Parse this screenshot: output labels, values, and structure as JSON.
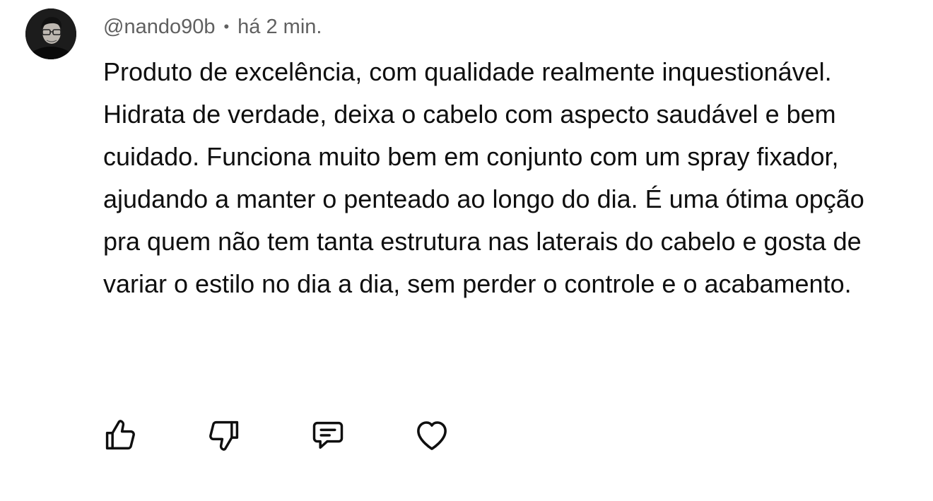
{
  "comment": {
    "author": "@nando90b",
    "separator": "•",
    "timestamp": "há 2 min.",
    "text": "Produto de excelência, com qualidade realmente inquestionável. Hidrata de verdade, deixa o cabelo com aspecto saudável e bem cuidado. Funciona muito bem em conjunto com um spray fixador, ajudando a manter o penteado ao longo do dia. É uma ótima opção pra quem não tem tanta estrutura nas laterais do cabelo e gosta de variar o estilo no dia a dia, sem perder o controle e o acabamento.",
    "avatar_icon": "user-avatar-photo"
  },
  "actions": [
    {
      "icon": "thumbs-up-icon"
    },
    {
      "icon": "thumbs-down-icon"
    },
    {
      "icon": "reply-comment-icon"
    },
    {
      "icon": "heart-icon"
    }
  ],
  "colors": {
    "text": "#0f0f0f",
    "meta": "#606060",
    "background": "#ffffff"
  }
}
